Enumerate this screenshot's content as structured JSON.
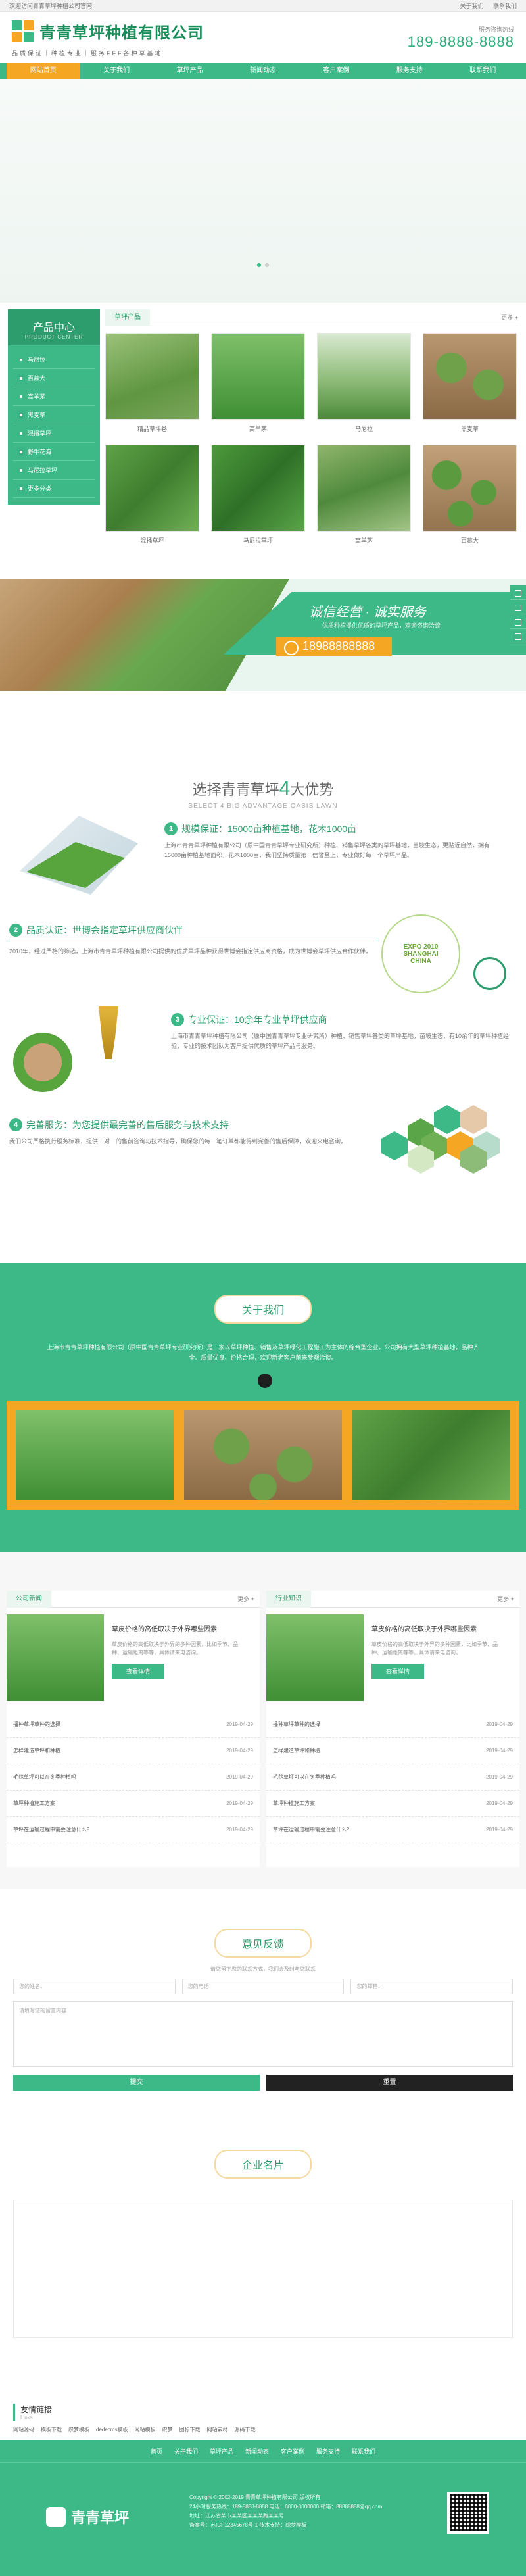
{
  "topbar": {
    "welcome": "欢迎访问青青草坪种植公司官网",
    "links": [
      "关于我们",
      "联系我们"
    ]
  },
  "header": {
    "company_name": "青青草坪种植有限公司",
    "slogan": "品质保证｜种植专业｜服务FFF各种草基地",
    "hotline_label": "服务咨询热线",
    "hotline_number": "189-8888-8888"
  },
  "nav": {
    "items": [
      "网站首页",
      "关于我们",
      "草坪产品",
      "新闻动态",
      "客户案例",
      "服务支持",
      "联系我们"
    ],
    "active_index": 0
  },
  "sidebar": {
    "title": "产品中心",
    "subtitle": "PRODUCT CENTER",
    "items": [
      "马尼拉",
      "百慕大",
      "高羊茅",
      "黑麦草",
      "混播草坪",
      "野牛花海",
      "马尼拉草坪",
      "更多分类"
    ]
  },
  "products": {
    "tab": "草坪产品",
    "more": "更多 +",
    "items": [
      {
        "name": "精品草坪卷"
      },
      {
        "name": "高羊茅",
        "note": ""
      },
      {
        "name": "马尼拉"
      },
      {
        "name": "黑麦草"
      },
      {
        "name": "混播草坪"
      },
      {
        "name": "马尼拉草坪"
      },
      {
        "name": "高羊茅"
      },
      {
        "name": "百慕大"
      }
    ]
  },
  "promo": {
    "title": "诚信经营 · 诚实服务",
    "subtitle": "优质种植提供优质的草坪产品，欢迎咨询洽谈",
    "tel": "18988888888"
  },
  "advantages": {
    "title_prefix": "选择青青草坪",
    "title_num": "4",
    "title_suffix": "大优势",
    "subtitle": "SELECT 4 BIG ADVANTAGE OASIS LAWN",
    "items": [
      {
        "num": "1",
        "heading": "规模保证：15000亩种植基地，花木1000亩",
        "text": "上海市青青草坪种植有限公司（原中国青青草坪专业研究所）种植、销售草坪各类的草坪基地，苗坡生态，更贴近自然，拥有15000亩种植基地面积，花木1000亩，我们坚持质量第一信誉至上，专业做好每一个草坪产品。"
      },
      {
        "num": "2",
        "heading": "品质认证：世博会指定草坪供应商伙伴",
        "text": "2010年，经过严格的筛选，上海市青青草坪种植有限公司提供的优质草坪品种获得世博会指定供应商资格，成为世博会草坪供应合作伙伴。"
      },
      {
        "num": "3",
        "heading": "专业保证：10余年专业草坪供应商",
        "text": "上海市青青草坪种植有限公司（原中国青青草坪专业研究所）种植、销售草坪各类的草坪基地，苗坡生态，有10余年的草坪种植经验，专业的技术团队为客户提供优质的草坪产品与服务。"
      },
      {
        "num": "4",
        "heading": "完善服务：为您提供最完善的售后服务与技术支持",
        "text": "我们公司严格执行服务标准，提供一对一的售前咨询与技术指导，确保您的每一笔订单都能得到完善的售后保障，欢迎来电咨询。"
      }
    ],
    "badge": "EXPO 2010 SHANGHAI CHINA"
  },
  "about": {
    "title": "关于我们",
    "text": "上海市青青草坪种植有限公司（原中国青青草坪专业研究所）是一家以草坪种植、销售及草坪绿化工程施工为主体的综合型企业，公司拥有大型草坪种植基地，品种齐全、质量优良、价格合理，欢迎新老客户前来参观洽谈。"
  },
  "news": {
    "company": {
      "tab": "公司新闻",
      "more": "更多 +",
      "featured_title": "草皮价格的高低取决于外界哪些因素",
      "featured_desc": "草皮价格的高低取决于外界的多种因素，比如季节、品种、运输距离等等，具体请来电咨询。",
      "button": "查看详情",
      "items": [
        {
          "title": "播种草坪草种的选择",
          "date": "2019-04-29"
        },
        {
          "title": "怎样建造草坪和种植",
          "date": "2019-04-29"
        },
        {
          "title": "毛毯草坪可以在冬季种植吗",
          "date": "2019-04-29"
        },
        {
          "title": "草坪种植施工方案",
          "date": "2019-04-29"
        },
        {
          "title": "草坪在运输过程中需要注意什么？",
          "date": "2019-04-29"
        }
      ]
    },
    "industry": {
      "tab": "行业知识",
      "more": "更多 +",
      "featured_title": "草皮价格的高低取决于外界哪些因素",
      "featured_desc": "草皮价格的高低取决于外界的多种因素，比如季节、品种、运输距离等等，具体请来电咨询。",
      "button": "查看详情",
      "items": [
        {
          "title": "播种草坪草种的选择",
          "date": "2019-04-29"
        },
        {
          "title": "怎样建造草坪和种植",
          "date": "2019-04-29"
        },
        {
          "title": "毛毯草坪可以在冬季种植吗",
          "date": "2019-04-29"
        },
        {
          "title": "草坪种植施工方案",
          "date": "2019-04-29"
        },
        {
          "title": "草坪在运输过程中需要注意什么？",
          "date": "2019-04-29"
        }
      ]
    }
  },
  "feedback": {
    "title": "意见反馈",
    "note": "请您留下您的联系方式，我们会及时与您联系",
    "placeholders": [
      "您的姓名：",
      "您的电话：",
      "您的邮箱："
    ],
    "message_placeholder": "请填写您的留言内容",
    "submit": "提交",
    "reset": "重置"
  },
  "card": {
    "title": "企业名片"
  },
  "friend_links": {
    "title": "友情链接",
    "subtitle": "Links",
    "items": [
      "网站源码",
      "模板下载",
      "织梦模板",
      "dedecms模板",
      "网站模板",
      "织梦",
      "图标下载",
      "网站素材",
      "源码下载"
    ]
  },
  "footer": {
    "nav": [
      "首页",
      "关于我们",
      "草坪产品",
      "新闻动态",
      "客户案例",
      "服务支持",
      "联系我们"
    ],
    "brand": "青青草坪",
    "info": [
      "Copyright © 2002-2019 青青草坪种植有限公司 版权所有",
      "24小时服务热线：189-8888-8888  电话：0000-0000000  邮箱：88888888@qq.com",
      "地址：江苏省某市某某区某某某路某某号",
      "备案号：苏ICP12345678号-1  技术支持：织梦模板"
    ]
  },
  "colors": {
    "brand": "#3cb987",
    "brand_dark": "#2e9d6e",
    "accent": "#f5a623"
  }
}
